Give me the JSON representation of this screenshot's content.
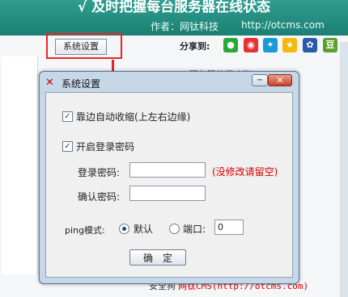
{
  "banner": {
    "title": "√ 及时把握每台服务器在线状态",
    "author": "作者：网钛科技",
    "url": "http://otcms.com"
  },
  "toolbar": {
    "settings_button": "系统设置",
    "share_label": "分享到:",
    "share_icons": [
      "wechat-icon",
      "weibo-icon",
      "qzone-icon",
      "star-icon",
      "baidu-icon",
      "douban-icon"
    ]
  },
  "background": {
    "partial_text": "…ms服务器使用功能",
    "bottom_text": "安全狗",
    "watermark": "网钛CMS(http://otcms.com)"
  },
  "dialog": {
    "title": "系统设置",
    "minimize_label": "−",
    "close_label": "✕",
    "edge_shrink": {
      "label": "靠边自动收缩(上左右边缘)",
      "checked": true
    },
    "login_password": {
      "label": "开启登录密码",
      "checked": true
    },
    "password_field": {
      "label": "登录密码:",
      "value": "",
      "hint": "(没修改请留空)"
    },
    "confirm_field": {
      "label": "确认密码:",
      "value": ""
    },
    "ping": {
      "label": "ping模式:",
      "options": [
        {
          "label": "默认",
          "selected": true
        },
        {
          "label": "端口:",
          "selected": false
        }
      ],
      "port_value": "0"
    },
    "ok_button": "确　定"
  },
  "colors": {
    "banner": "#1c7f74",
    "highlight": "#e22222",
    "hint": "#d60000"
  }
}
